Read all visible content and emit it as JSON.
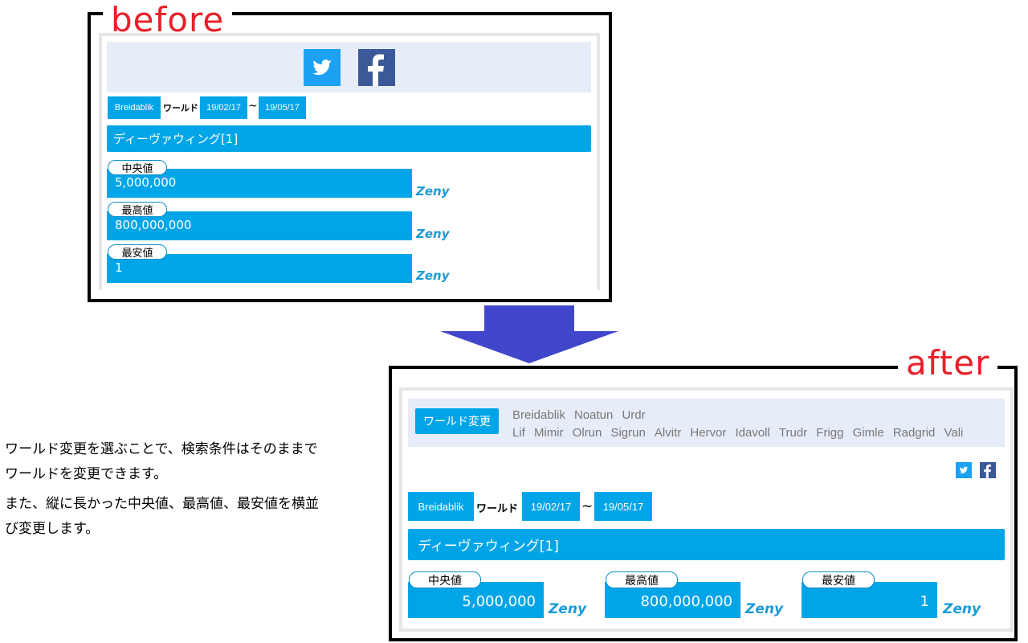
{
  "labels": {
    "before": "before",
    "after": "after"
  },
  "world": "Breidablik",
  "world_label": "ワールド",
  "date_from": "19/02/17",
  "tilde": "~",
  "date_to": "19/05/17",
  "item_name": "ディーヴァウィング[1]",
  "stats": [
    {
      "label": "中央値",
      "value": "5,000,000",
      "unit": "Zeny"
    },
    {
      "label": "最高値",
      "value": "800,000,000",
      "unit": "Zeny"
    },
    {
      "label": "最安値",
      "value": "1",
      "unit": "Zeny"
    }
  ],
  "world_change_button": "ワールド変更",
  "worlds_row1": [
    "Breidablik",
    "Noatun",
    "Urdr"
  ],
  "worlds_row2": [
    "Lif",
    "Mimir",
    "Olrun",
    "Sigrun",
    "Alvitr",
    "Hervor",
    "Idavoll",
    "Trudr",
    "Frigg",
    "Gimle",
    "Radgrid",
    "Vali"
  ],
  "description": [
    "ワールド変更を選ぶことで、検索条件はそのままで",
    "ワールドを変更できます。",
    "また、縦に長かった中央値、最高値、最安値を横並",
    "び変更します。"
  ],
  "colors": {
    "accent": "#00a5e8",
    "label_red": "#e8202a",
    "arrow": "#3f46c9",
    "twitter": "#1da1f2",
    "facebook": "#3b5998"
  },
  "icons": [
    "twitter-icon",
    "facebook-icon",
    "down-arrow"
  ]
}
